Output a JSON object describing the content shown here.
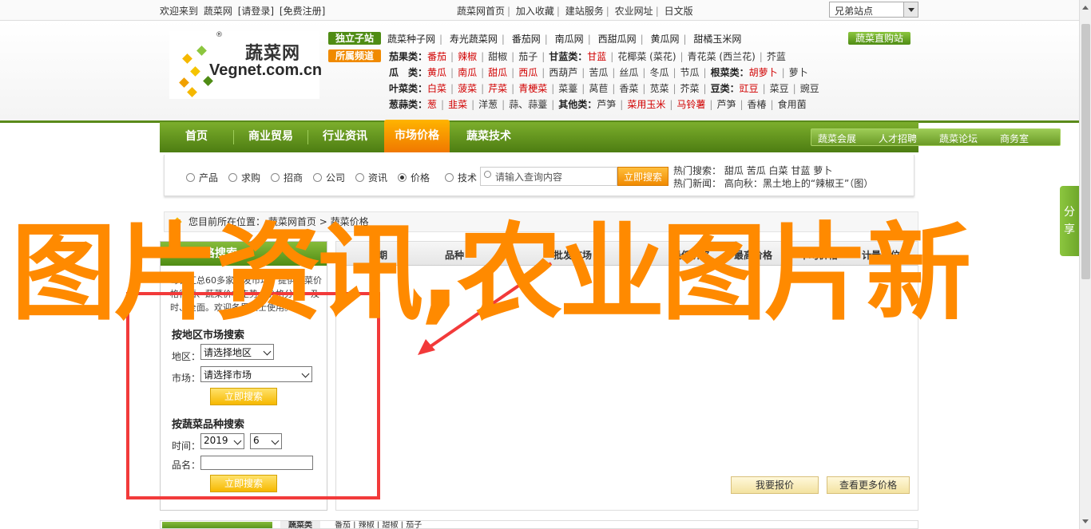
{
  "topbar": {
    "welcome": "欢迎来到",
    "site_link": "蔬菜网",
    "login": "[请登录]",
    "register": "[免费注册]",
    "links": [
      "蔬菜网首页",
      "加入收藏",
      "建站服务",
      "农业网址",
      "日文版"
    ],
    "site_select": "兄弟站点"
  },
  "logo": {
    "name_cn": "蔬菜网",
    "name_en": "Vegnet.com.cn",
    "reg": "®"
  },
  "categories": {
    "tag_sites": "独立子站",
    "tag_channels": "所属频道",
    "sites": [
      "蔬菜种子网",
      "寿光蔬菜网",
      "番茄网",
      "南瓜网",
      "西甜瓜网",
      "黄瓜网",
      "甜橘玉米网"
    ],
    "download": "蔬菜直购站",
    "rows": [
      {
        "label": "茄果类：",
        "items": [
          {
            "t": "番茄",
            "r": true
          },
          {
            "t": "辣椒",
            "r": true
          },
          {
            "t": "甜椒",
            "r": false
          },
          {
            "t": "茄子",
            "r": false
          }
        ],
        "label2": "甘蓝类：",
        "items2": [
          {
            "t": "甘蓝",
            "r": true
          },
          {
            "t": "花椰菜 (菜花)",
            "r": false
          },
          {
            "t": "青花菜 (西兰花)",
            "r": false
          },
          {
            "t": "芥蓝",
            "r": false
          }
        ]
      },
      {
        "label": "瓜　类：",
        "items": [
          {
            "t": "黄瓜",
            "r": true
          },
          {
            "t": "南瓜",
            "r": true
          },
          {
            "t": "甜瓜",
            "r": true
          },
          {
            "t": "西瓜",
            "r": true
          },
          {
            "t": "西葫芦",
            "r": false
          },
          {
            "t": "苦瓜",
            "r": false
          },
          {
            "t": "丝瓜",
            "r": false
          },
          {
            "t": "冬瓜",
            "r": false
          },
          {
            "t": "节瓜",
            "r": false
          }
        ],
        "label2": "根菜类：",
        "items2": [
          {
            "t": "胡萝卜",
            "r": true
          },
          {
            "t": "萝卜",
            "r": false
          }
        ]
      },
      {
        "label": "叶菜类：",
        "items": [
          {
            "t": "白菜",
            "r": true
          },
          {
            "t": "菠菜",
            "r": true
          },
          {
            "t": "芹菜",
            "r": true
          },
          {
            "t": "青梗菜",
            "r": true
          },
          {
            "t": "菜薹",
            "r": false
          },
          {
            "t": "莴苣",
            "r": false
          },
          {
            "t": "香菜",
            "r": false
          },
          {
            "t": "苋菜",
            "r": false
          },
          {
            "t": "芥菜",
            "r": false
          }
        ],
        "label2": "豆类：",
        "items2": [
          {
            "t": "豇豆",
            "r": true
          },
          {
            "t": "菜豆",
            "r": false
          },
          {
            "t": "豌豆",
            "r": false
          }
        ]
      },
      {
        "label": "葱蒜类：",
        "items": [
          {
            "t": "葱",
            "r": true
          },
          {
            "t": "韭菜",
            "r": true
          },
          {
            "t": "洋葱",
            "r": false
          },
          {
            "t": "蒜、蒜薹",
            "r": false
          }
        ],
        "label2": "其他类：",
        "items2": [
          {
            "t": "芦笋",
            "r": false
          },
          {
            "t": "菜用玉米",
            "r": true
          },
          {
            "t": "马铃薯",
            "r": true
          },
          {
            "t": "芦笋",
            "r": false
          },
          {
            "t": "香椿",
            "r": false
          },
          {
            "t": "食用菌",
            "r": false
          }
        ]
      }
    ]
  },
  "nav": {
    "items": [
      "首页",
      "商业贸易",
      "行业资讯",
      "市场价格",
      "蔬菜技术"
    ],
    "active_index": 3,
    "sub": [
      "蔬菜会展",
      "人才招聘",
      "蔬菜论坛",
      "商务室"
    ]
  },
  "search": {
    "radios": [
      "产品",
      "求购",
      "招商",
      "公司",
      "资讯",
      "价格",
      "技术"
    ],
    "checked_index": 5,
    "placeholder": "请输入查询内容",
    "button": "立即搜索",
    "hot_label": "热门搜索：",
    "hot_items": [
      "甜瓜",
      "苦瓜",
      "白菜",
      "甘蓝",
      "萝卜"
    ],
    "news_label": "热门新闻：",
    "news": "高向秋：黑土地上的“辣椒王”（图）"
  },
  "breadcrumb": {
    "label": "您目前所在位置：",
    "home": "蔬菜网首页",
    "sep": ">",
    "current": "蔬菜价格"
  },
  "leftpanel": {
    "title": "蔬菜价格搜索",
    "intro": "每日汇总60多家批发市场，提供蔬菜价格行情、蔬菜价格走势、价格分析，及时、全面。欢迎各界人士使用。",
    "region_title": "按地区市场搜索",
    "area_label": "地区：",
    "area_value": "请选择地区",
    "market_label": "市场：",
    "market_value": "请选择市场",
    "btn1": "立即搜索",
    "variety_title": "按蔬菜品种搜索",
    "time_label": "时间：",
    "year": "2019",
    "month": "6",
    "name_label": "品名：",
    "btn2": "立即搜索"
  },
  "table": {
    "headers": [
      "日期",
      "品种",
      "批发市场",
      "最低价格",
      "最高价格",
      "平均价格",
      "计量单位"
    ],
    "report_btn": "我要报价",
    "more_btn": "查看更多价格"
  },
  "share": {
    "label1": "分",
    "label2": "享"
  },
  "bottom": {
    "tag": "蔬菜类",
    "items": [
      "番茄",
      "辣椒",
      "甜椒",
      "茄子"
    ]
  },
  "overlay": {
    "text": "图片资讯,农业图片新"
  },
  "colors": {
    "brand_green": "#4f8c14",
    "accent_orange": "#f08a00",
    "overlay_orange": "#ff8a00",
    "mark_red": "#f23a3a"
  }
}
